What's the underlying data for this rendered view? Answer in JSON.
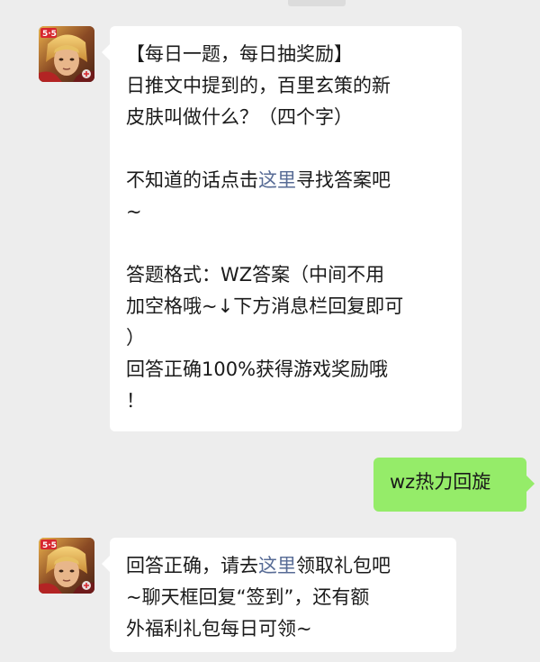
{
  "messages": [
    {
      "sender": "game-official",
      "avatar_icon": "game-hero-avatar-icon",
      "lines": {
        "l1": "【每日一题，每日抽奖励】",
        "l2": "日推文中提到的，百里玄策的新",
        "l3": "皮肤叫做什么？（四个字）",
        "l4_before": "不知道的话点击",
        "l4_link": "这里",
        "l4_after": "寻找答案吧",
        "l5": "~",
        "l6": "答题格式：WZ答案（中间不用",
        "l7": "加空格哦~↓下方消息栏回复即可",
        "l8": "）",
        "l9": "回答正确100%获得游戏奖励哦",
        "l10": "！"
      }
    },
    {
      "sender": "me",
      "text": "wz热力回旋"
    },
    {
      "sender": "game-official",
      "avatar_icon": "game-hero-avatar-icon",
      "lines": {
        "l1_before": "回答正确，请去",
        "l1_link": "这里",
        "l1_after": "领取礼包吧",
        "l2": "~聊天框回复“签到”，还有额",
        "l3": "外福利礼包每日可领~"
      }
    }
  ],
  "colors": {
    "background": "#ededed",
    "incoming_bubble": "#ffffff",
    "outgoing_bubble": "#95ec69",
    "link": "#576b95"
  }
}
